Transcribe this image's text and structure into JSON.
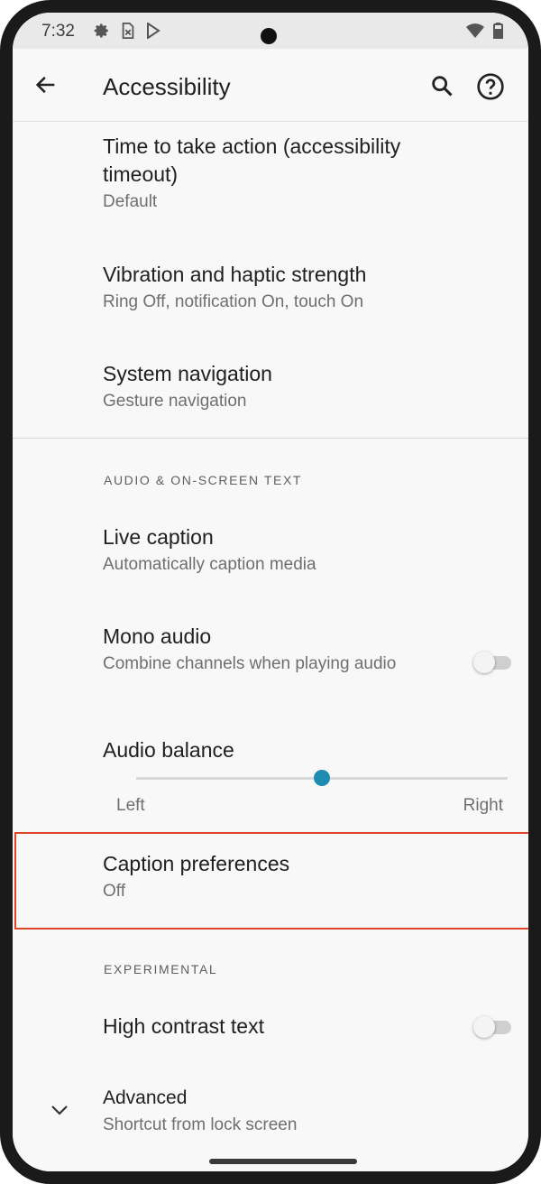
{
  "status_bar": {
    "time": "7:32"
  },
  "app_bar": {
    "title": "Accessibility"
  },
  "items": {
    "timeout": {
      "title": "Time to take action (accessibility timeout)",
      "subtitle": "Default"
    },
    "vibration": {
      "title": "Vibration and haptic strength",
      "subtitle": "Ring Off, notification On, touch On"
    },
    "system_navigation": {
      "title": "System navigation",
      "subtitle": "Gesture navigation"
    },
    "live_caption": {
      "title": "Live caption",
      "subtitle": "Automatically caption media"
    },
    "mono_audio": {
      "title": "Mono audio",
      "subtitle": "Combine channels when playing audio",
      "enabled": false
    },
    "audio_balance": {
      "title": "Audio balance",
      "left_label": "Left",
      "right_label": "Right",
      "value": 0.5
    },
    "caption_preferences": {
      "title": "Caption preferences",
      "subtitle": "Off"
    },
    "high_contrast": {
      "title": "High contrast text",
      "enabled": false
    },
    "advanced": {
      "title": "Advanced",
      "subtitle": "Shortcut from lock screen"
    }
  },
  "sections": {
    "audio_header": "AUDIO & ON-SCREEN TEXT",
    "experimental_header": "EXPERIMENTAL"
  },
  "colors": {
    "accent": "#1e8bb0",
    "highlight_border": "#e0442b"
  }
}
